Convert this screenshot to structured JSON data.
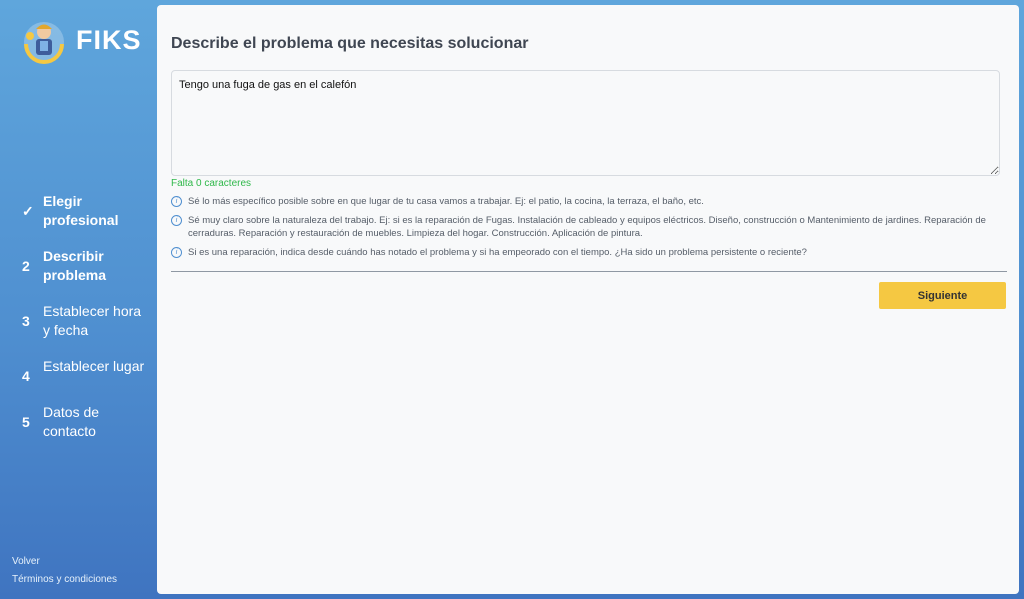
{
  "brand": {
    "name": "FIKS"
  },
  "sidebar": {
    "steps": [
      {
        "marker": "✓",
        "label": "Elegir profesional"
      },
      {
        "marker": "2",
        "label": "Describir problema"
      },
      {
        "marker": "3",
        "label": "Establecer hora y fecha"
      },
      {
        "marker": "4",
        "label": "Establecer lugar"
      },
      {
        "marker": "5",
        "label": "Datos de contacto"
      }
    ],
    "back_label": "Volver",
    "terms_label": "Términos y condiciones"
  },
  "main": {
    "title": "Describe el problema que necesitas solucionar",
    "description_value": "Tengo una fuga de gas en el calefón",
    "counter_text": "Falta 0 caracteres",
    "tips": [
      "Sé lo más específico posible sobre en que lugar de tu casa vamos a trabajar. Ej: el patio, la cocina, la terraza, el baño, etc.",
      "Sé muy claro sobre la naturaleza del trabajo. Ej: si es la reparación de Fugas. Instalación de cableado y equipos eléctricos. Diseño, construcción o Mantenimiento de jardines. Reparación de cerraduras. Reparación y restauración de muebles. Limpieza del hogar. Construcción. Aplicación de pintura.",
      "Si es una reparación, indica desde cuándo has notado el problema y si ha empeorado con el tiempo. ¿Ha sido un problema persistente o reciente?"
    ],
    "tip_icon": "i",
    "next_label": "Siguiente"
  },
  "colors": {
    "accent": "#f5c842",
    "sidebar_top": "#5fa6dc",
    "sidebar_bottom": "#3f74c0",
    "counter": "#2fb84a"
  }
}
